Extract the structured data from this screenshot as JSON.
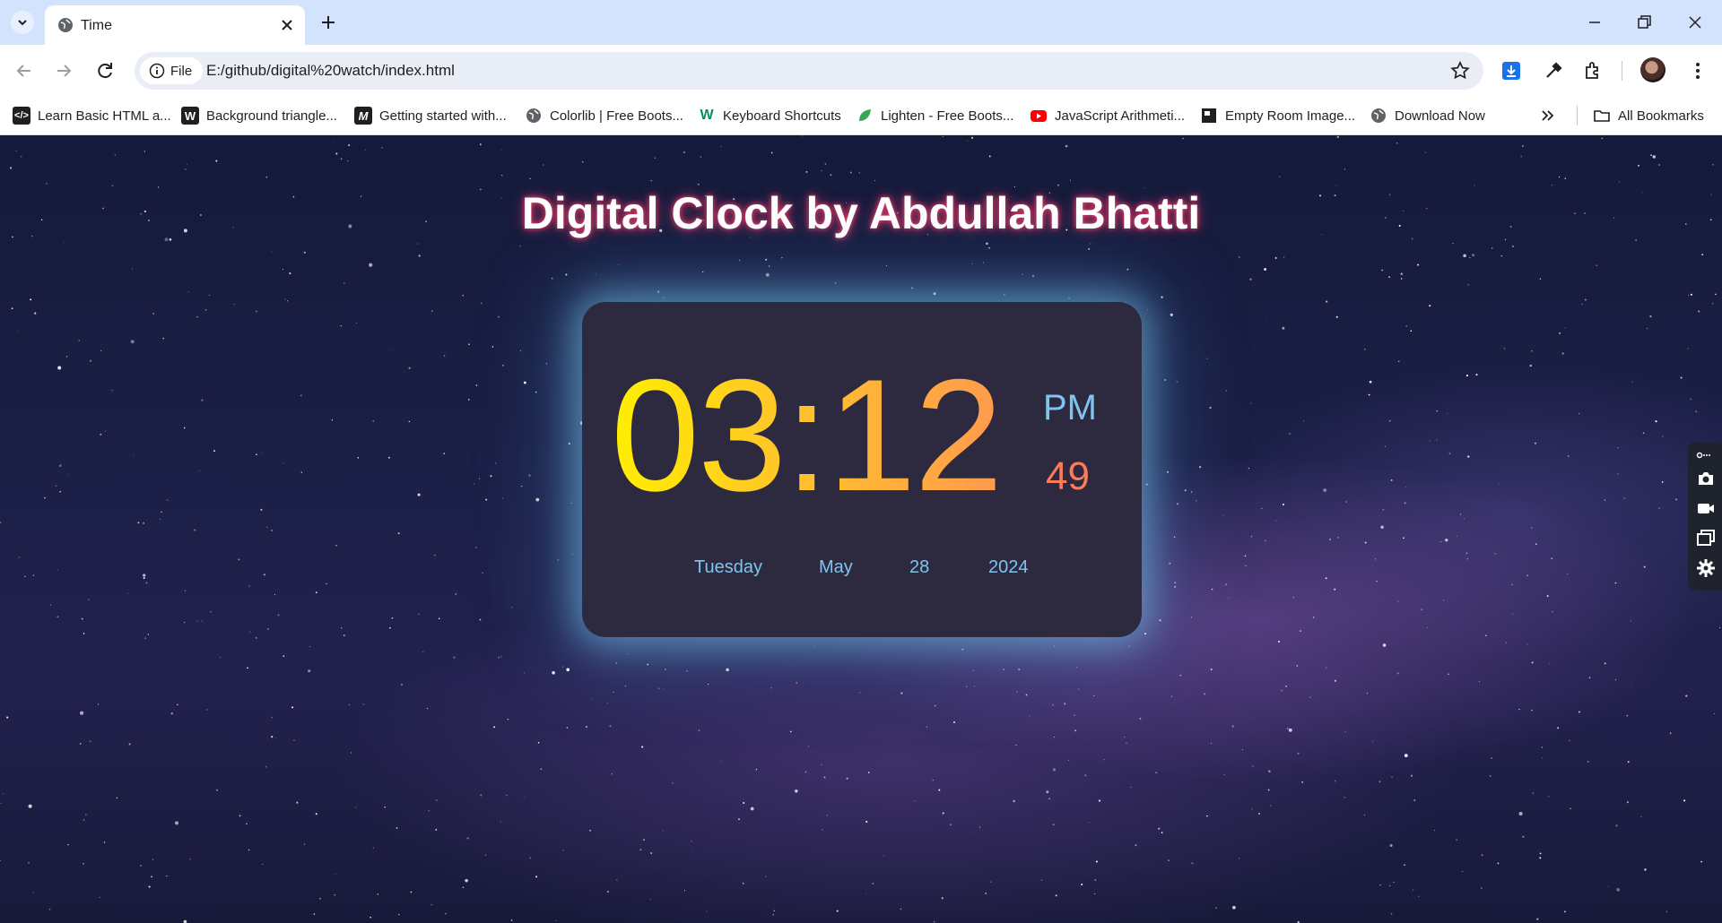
{
  "browser": {
    "tab": {
      "title": "Time"
    },
    "address": {
      "chip_label": "File",
      "url": "E:/github/digital%20watch/index.html"
    },
    "bookmarks": [
      {
        "label": "Learn Basic HTML a...",
        "icon": "html-icon"
      },
      {
        "label": "Background triangle...",
        "icon": "w-icon"
      },
      {
        "label": "Getting started with...",
        "icon": "m-icon"
      },
      {
        "label": "Colorlib | Free Boots...",
        "icon": "globe-icon"
      },
      {
        "label": "Keyboard Shortcuts",
        "icon": "w-green-icon"
      },
      {
        "label": "Lighten - Free Boots...",
        "icon": "leaf-icon"
      },
      {
        "label": "JavaScript Arithmeti...",
        "icon": "youtube-icon"
      },
      {
        "label": "Empty Room Image...",
        "icon": "unsplash-icon"
      },
      {
        "label": "Download Now",
        "icon": "globe-icon"
      }
    ],
    "all_bookmarks_label": "All Bookmarks"
  },
  "page": {
    "heading": "Digital Clock by Abdullah Bhatti",
    "clock": {
      "time": "03:12",
      "ampm": "PM",
      "seconds": "49",
      "day": "Tuesday",
      "month": "May",
      "date": "28",
      "year": "2024"
    }
  },
  "colors": {
    "tabbar": "#d3e3fd",
    "clock_bg": "#2d2a40",
    "accent_blue": "#7fc4ee",
    "seconds": "#ff7a58",
    "time_gradient_start": "#ffef00",
    "time_gradient_end": "#ff9a4e"
  }
}
